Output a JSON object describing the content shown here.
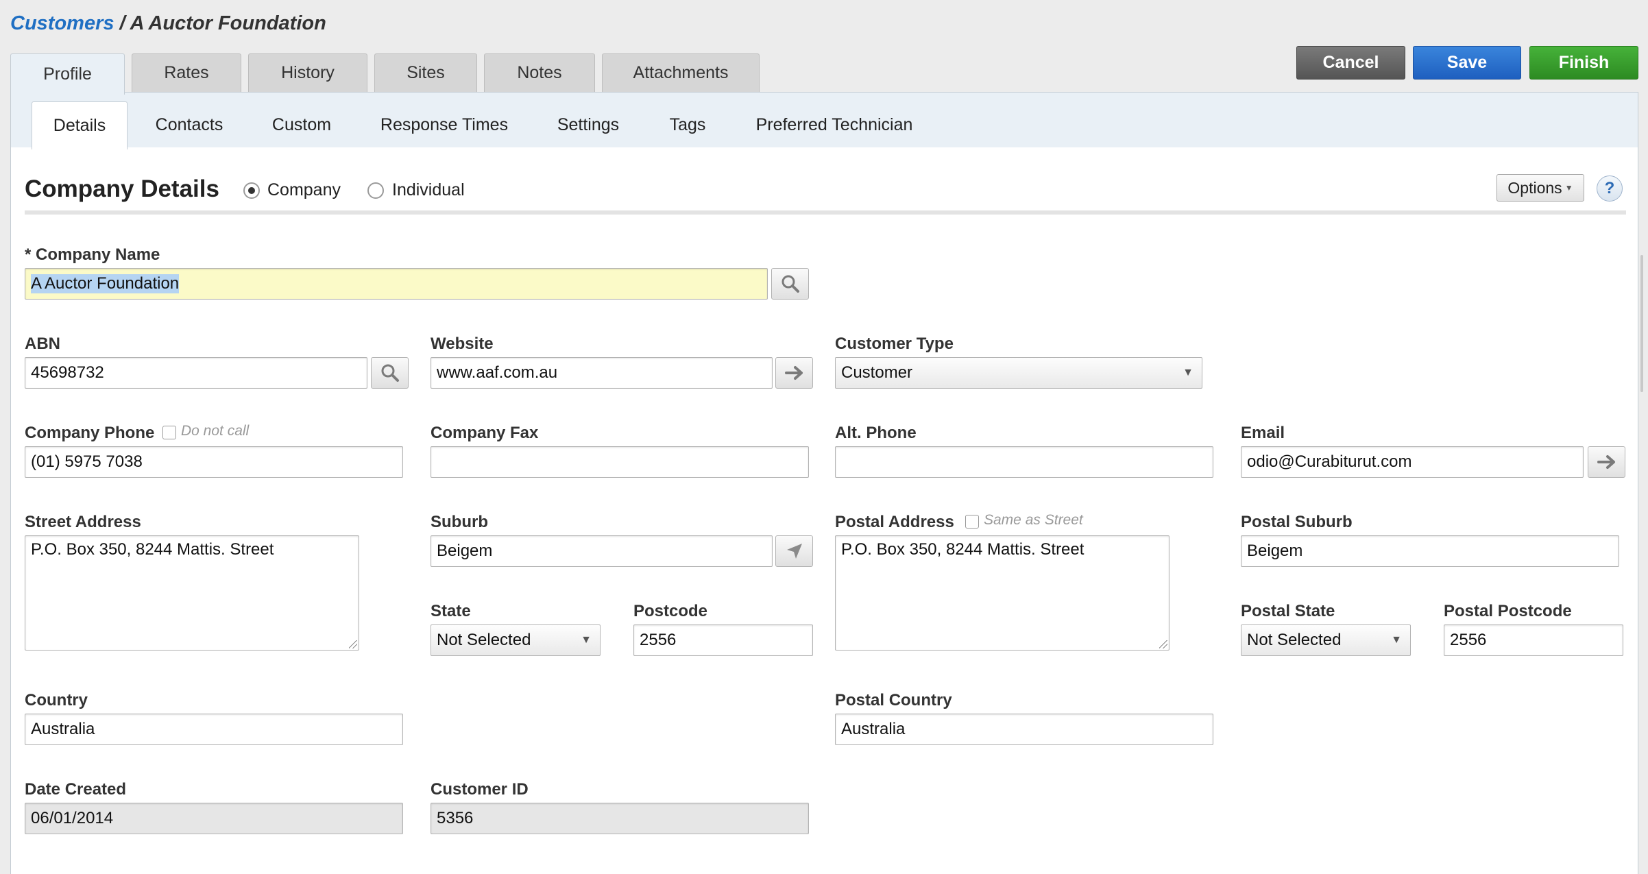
{
  "breadcrumb": {
    "root": "Customers",
    "separator": " / ",
    "current": "A Auctor Foundation"
  },
  "top_tabs": [
    {
      "label": "Profile",
      "active": true
    },
    {
      "label": "Rates"
    },
    {
      "label": "History"
    },
    {
      "label": "Sites"
    },
    {
      "label": "Notes"
    },
    {
      "label": "Attachments"
    }
  ],
  "actions": {
    "cancel": "Cancel",
    "save": "Save",
    "finish": "Finish"
  },
  "sub_tabs": [
    {
      "label": "Details",
      "active": true
    },
    {
      "label": "Contacts"
    },
    {
      "label": "Custom"
    },
    {
      "label": "Response Times"
    },
    {
      "label": "Settings"
    },
    {
      "label": "Tags"
    },
    {
      "label": "Preferred Technician"
    }
  ],
  "section": {
    "title": "Company Details",
    "radio_company": "Company",
    "radio_individual": "Individual",
    "selected": "Company",
    "options_label": "Options",
    "help_label": "?"
  },
  "fields": {
    "company_name": {
      "label": "* Company Name",
      "value": "A Auctor Foundation"
    },
    "abn": {
      "label": "ABN",
      "value": "45698732"
    },
    "website": {
      "label": "Website",
      "value": "www.aaf.com.au"
    },
    "customer_type": {
      "label": "Customer Type",
      "value": "Customer"
    },
    "company_phone": {
      "label": "Company Phone",
      "value": "(01) 5975 7038",
      "do_not_call": "Do not call"
    },
    "company_fax": {
      "label": "Company Fax",
      "value": ""
    },
    "alt_phone": {
      "label": "Alt. Phone",
      "value": ""
    },
    "email": {
      "label": "Email",
      "value": "odio@Curabiturut.com"
    },
    "street_address": {
      "label": "Street Address",
      "value": "P.O. Box 350, 8244 Mattis. Street"
    },
    "suburb": {
      "label": "Suburb",
      "value": "Beigem"
    },
    "state": {
      "label": "State",
      "value": "Not Selected"
    },
    "postcode": {
      "label": "Postcode",
      "value": "2556"
    },
    "postal_address": {
      "label": "Postal Address",
      "value": "P.O. Box 350, 8244 Mattis. Street",
      "same_as_street": "Same as Street"
    },
    "postal_suburb": {
      "label": "Postal Suburb",
      "value": "Beigem"
    },
    "postal_state": {
      "label": "Postal State",
      "value": "Not Selected"
    },
    "postal_postcode": {
      "label": "Postal Postcode",
      "value": "2556"
    },
    "country": {
      "label": "Country",
      "value": "Australia"
    },
    "postal_country": {
      "label": "Postal Country",
      "value": "Australia"
    },
    "date_created": {
      "label": "Date Created",
      "value": "06/01/2014"
    },
    "customer_id": {
      "label": "Customer ID",
      "value": "5356"
    }
  },
  "icons": {
    "search": "search-icon",
    "arrow": "arrow-right-icon",
    "locate": "location-arrow-icon",
    "caret": "chevron-down-icon"
  },
  "colors": {
    "link": "#1f6fc3",
    "save": "#1e5fbf",
    "finish": "#2d8b22",
    "cancel": "#555555",
    "highlight_input": "#fbfac8"
  }
}
